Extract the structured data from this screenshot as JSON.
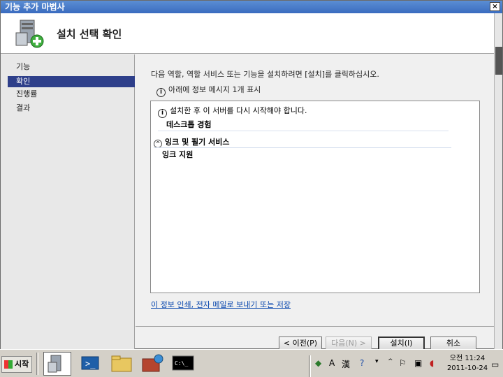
{
  "window": {
    "title": "기능 추가 마법사",
    "close": "×",
    "header_title": "설치 선택 확인"
  },
  "sidebar": {
    "items": [
      {
        "label": "기능"
      },
      {
        "label": "확인"
      },
      {
        "label": "진행률"
      },
      {
        "label": "결과"
      }
    ]
  },
  "main": {
    "intro": "다음 역할, 역할 서비스 또는 기능을 설치하려면 [설치]를 클릭하십시오.",
    "info_message": "아래에 정보 메시지 1개 표시",
    "box": {
      "restart_notice": "설치한 후 이 서버를 다시 시작해야 합니다.",
      "item1": "데스크톱 경험",
      "group": "잉크 및 필기 서비스",
      "item2": "잉크 지원"
    },
    "link": "이 정보 인쇄, 전자 메일로 보내기 또는 저장"
  },
  "buttons": {
    "prev": "< 이전(P)",
    "next": "다음(N) >",
    "install": "설치(I)",
    "cancel": "취소"
  },
  "taskbar": {
    "start": "시작",
    "ime": "A",
    "hanja": "漢",
    "time": "오전 11:24",
    "date": "2011-10-24"
  },
  "colors": {
    "sidebar_active": "#2e3f8a",
    "link": "#0645ad",
    "titlebar": "#3a6bbf"
  }
}
